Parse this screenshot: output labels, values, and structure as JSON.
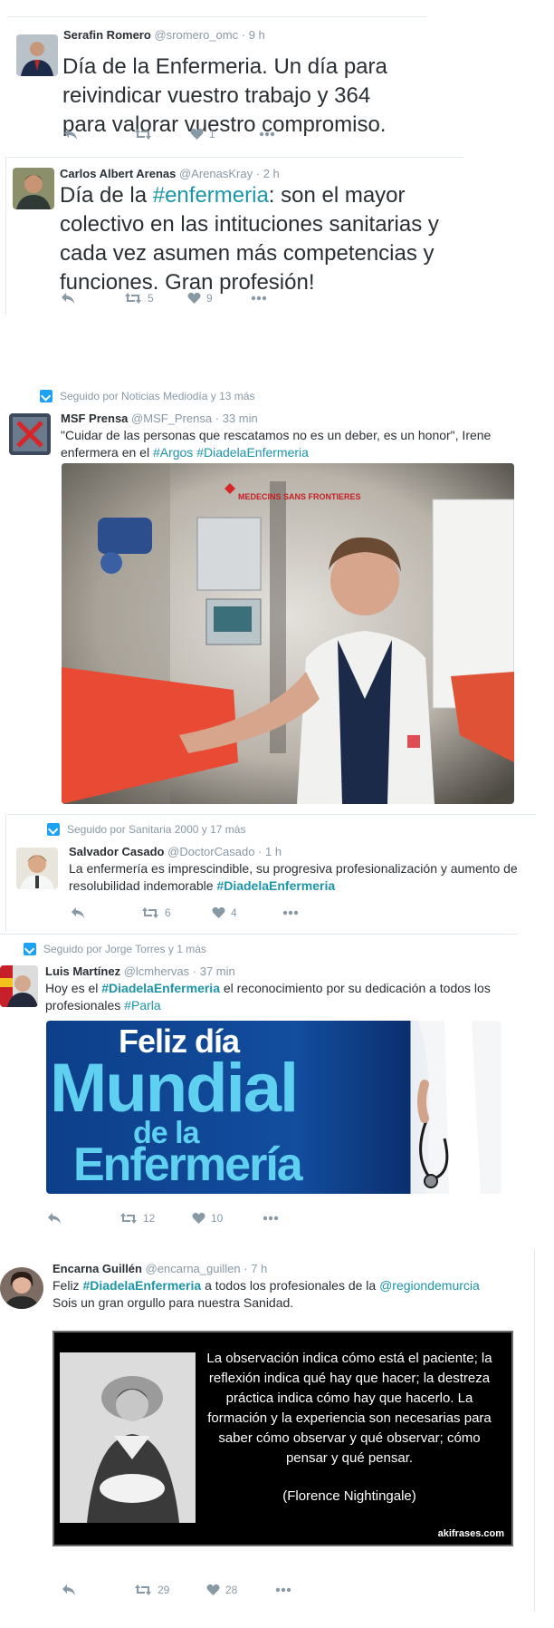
{
  "tweets": [
    {
      "name": "Serafin Romero",
      "handle": "@sromero_omc",
      "time": "9 h",
      "text": "Día de la Enfermeria. Un día para reivindicar vuestro trabajo y 364 para valorar vuestro compromiso.",
      "likes": "1"
    },
    {
      "name": "Carlos Albert Arenas",
      "handle": "@ArenasKray",
      "time": "2 h",
      "text_pre": "Día de la ",
      "hashtag": "#enfermeria",
      "text_post": ": son el mayor colectivo en las intituciones sanitarias y cada vez asumen más competencias y funciones. Gran profesión!",
      "retweets": "5",
      "likes": "9"
    },
    {
      "followed_by": "Seguido por Noticias Mediodía y 13 más",
      "name": "MSF Prensa",
      "handle": "@MSF_Prensa",
      "time": "33 min",
      "text_pre": "\"Cuidar de las personas que rescatamos no es un deber, es un honor\", Irene enfermera en el ",
      "hashtag1": "#Argos",
      "hashtag2": "#DiadelaEnfermeria",
      "photo_label": "MEDECINS SANS FRONTIERES"
    },
    {
      "followed_by": "Seguido por Sanitaria 2000 y 17 más",
      "name": "Salvador Casado",
      "handle": "@DoctorCasado",
      "time": "1 h",
      "text_pre": "La enfermería es imprescindible, su progresiva profesionalización y aumento de resolubilidad indemorable ",
      "hashtag": "#DiadelaEnfermeria",
      "retweets": "6",
      "likes": "4"
    },
    {
      "followed_by": "Seguido por Jorge Torres y 1 más",
      "name": "Luis Martínez",
      "handle": "@lcmhervas",
      "time": "37 min",
      "text_a": "Hoy es el ",
      "hashtag": "#DiadelaEnfermeria",
      "text_b": " el  reconocimiento por su dedicación a todos los profesionales ",
      "hashtag2": "#Parla",
      "banner_line1": "Feliz día",
      "banner_line2": "Mundial",
      "banner_line3": "de la",
      "banner_line4": "Enfermería",
      "retweets": "12",
      "likes": "10"
    },
    {
      "name": "Encarna Guillén",
      "handle": "@encarna_guillen",
      "time": "7 h",
      "text_a": "Feliz ",
      "hashtag": "#DiadelaEnfermeria",
      "text_b": " a todos los profesionales de la ",
      "mention": "@regiondemurcia",
      "text_c": "Sois un gran orgullo para nuestra Sanidad.",
      "quote": "La observación indica cómo está el paciente; la reflexión indica qué hay que hacer; la destreza práctica indica cómo hay que hacerlo. La formación y la experiencia son necesarias para saber cómo observar y qué observar; cómo pensar y qué pensar.",
      "quote_author": "(Florence Nightingale)",
      "watermark": "akifrases.com",
      "retweets": "29",
      "likes": "28"
    }
  ],
  "colors": {
    "accent": "#1b95a8",
    "meta": "#8899a6",
    "text": "#292f33",
    "follow_icon": "#1da1f2"
  },
  "icons": [
    "reply-icon",
    "retweet-icon",
    "like-icon",
    "more-icon",
    "followed-icon"
  ]
}
